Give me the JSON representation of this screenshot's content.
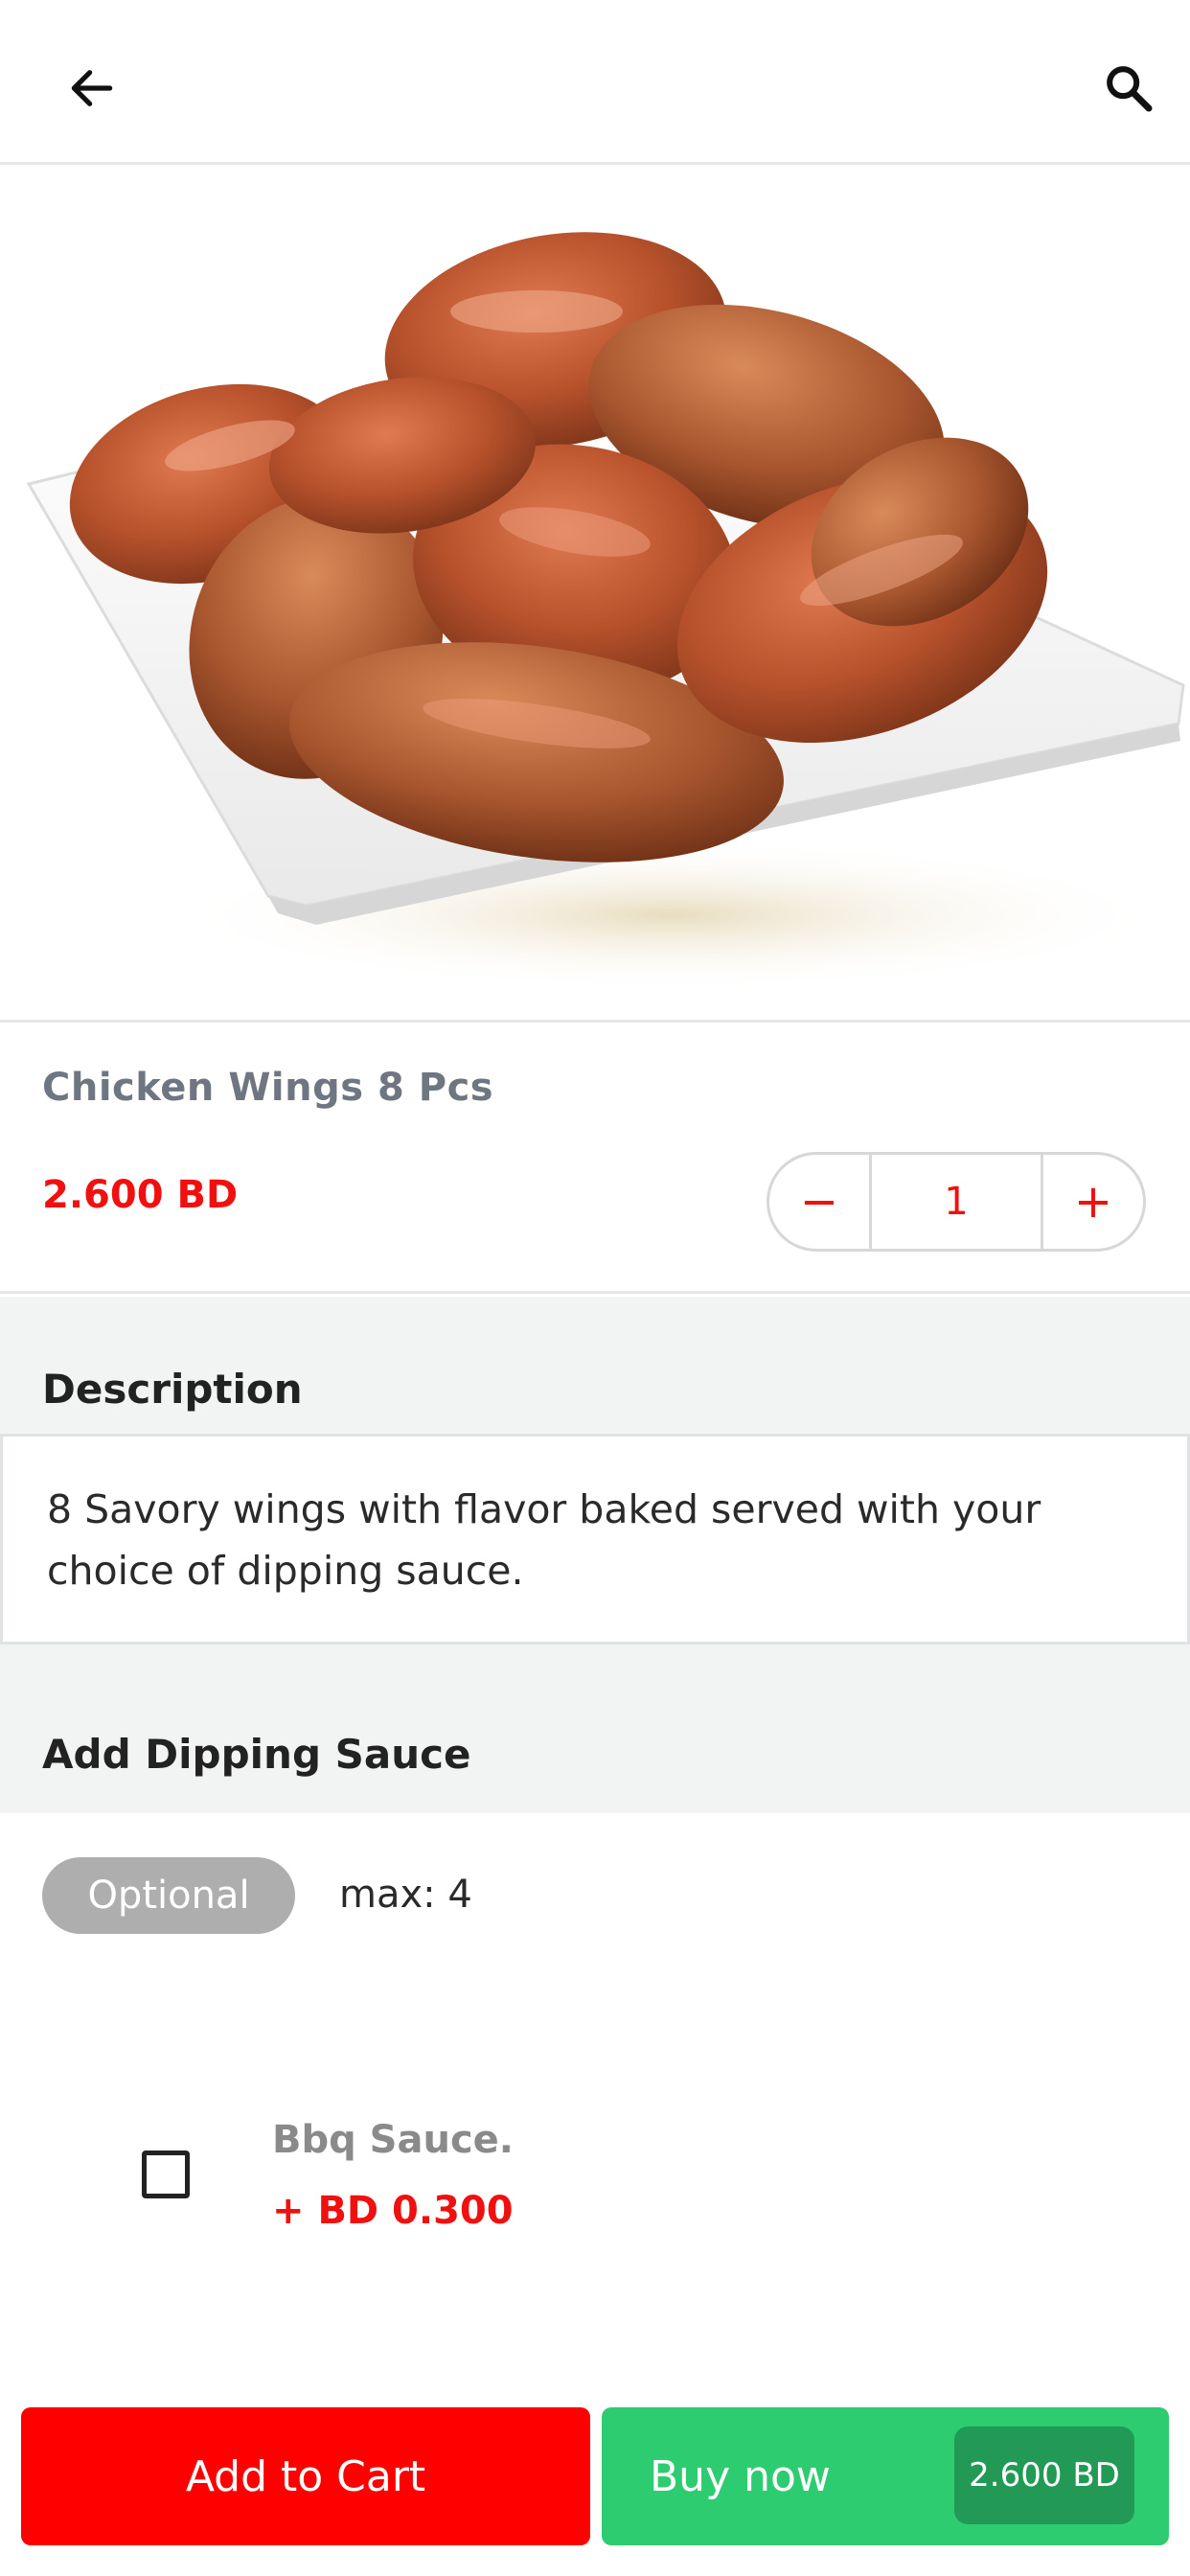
{
  "header": {
    "back_icon": "arrow-left-icon",
    "search_icon": "search-icon"
  },
  "product": {
    "title": "Chicken Wings 8 Pcs",
    "price": "2.600 BD",
    "quantity": "1",
    "decrement_label": "−",
    "increment_label": "+"
  },
  "description": {
    "heading": "Description",
    "text": "8 Savory wings with flavor baked served with your choice of dipping sauce."
  },
  "dipping_sauce": {
    "heading": "Add Dipping Sauce",
    "optional_label": "Optional",
    "max_label": "max: 4",
    "items": [
      {
        "name": "Bbq Sauce.",
        "price": "+ BD 0.300",
        "checked": false
      }
    ]
  },
  "actions": {
    "add_to_cart": "Add to Cart",
    "buy_now": "Buy now",
    "buy_now_price": "2.600 BD"
  },
  "colors": {
    "accent_red": "#f01010",
    "cart_red": "#ff0000",
    "buy_green": "#2ecc71",
    "buy_price_green": "#229955"
  }
}
